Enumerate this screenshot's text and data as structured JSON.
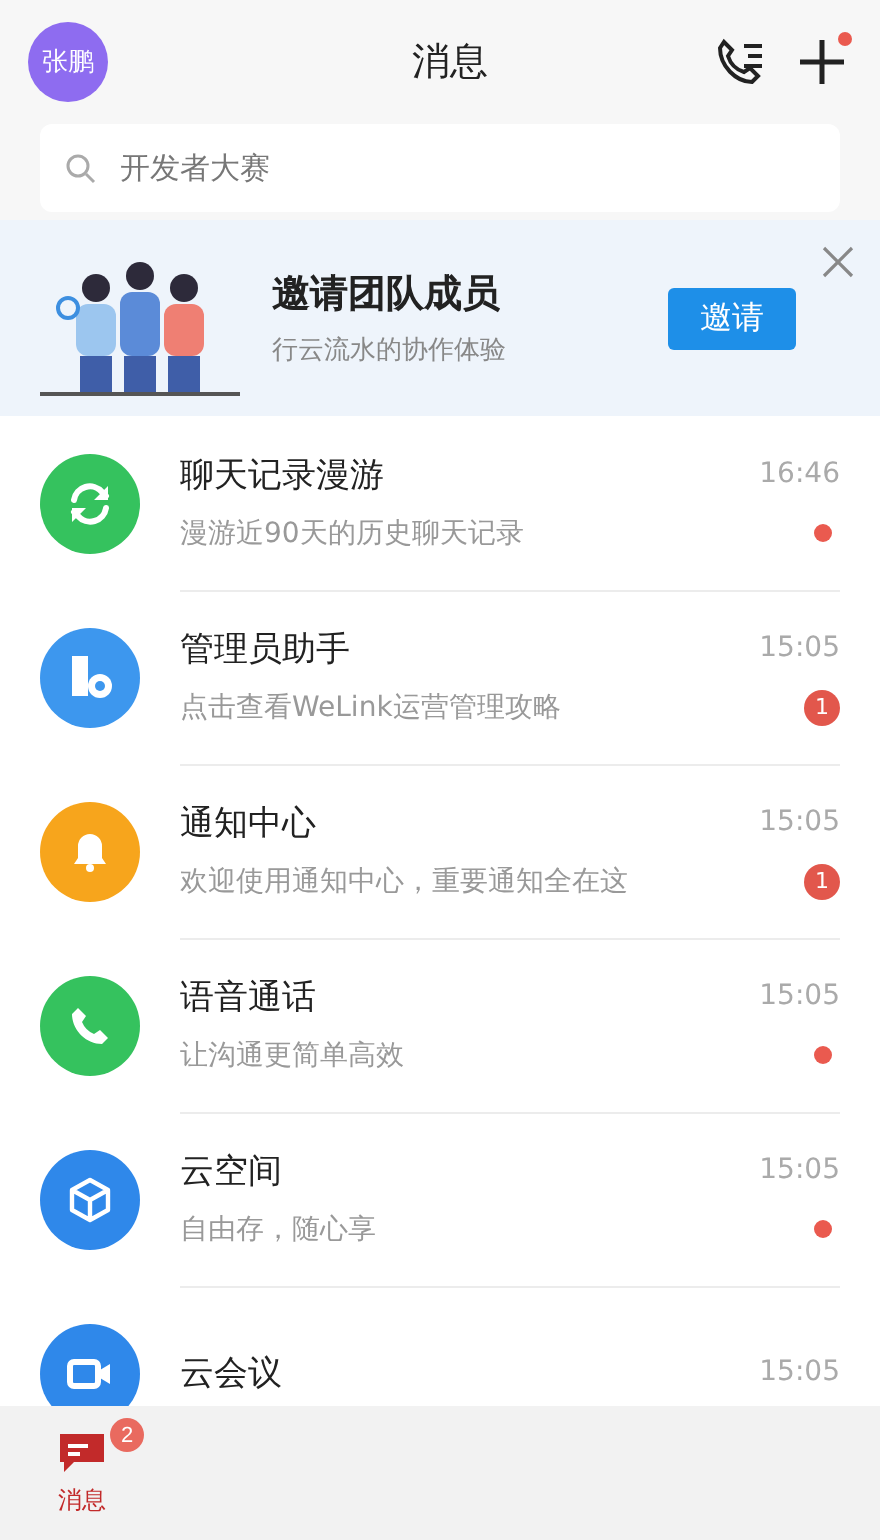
{
  "header": {
    "avatar": "张鹏",
    "title": "消息",
    "plus_dot": true
  },
  "search": {
    "placeholder": "开发者大赛"
  },
  "banner": {
    "title": "邀请团队成员",
    "subtitle": "行云流水的协作体验",
    "button": "邀请"
  },
  "chats": [
    {
      "name": "聊天记录漫游",
      "preview": "漫游近90天的历史聊天记录",
      "time": "16:46",
      "color": "#35c25e",
      "unread": {
        "kind": "dot"
      }
    },
    {
      "name": "管理员助手",
      "preview": "点击查看WeLink运营管理攻略",
      "time": "15:05",
      "color": "#3d97ee",
      "unread": {
        "kind": "count",
        "count": "1"
      }
    },
    {
      "name": "通知中心",
      "preview": "欢迎使用通知中心，重要通知全在这",
      "time": "15:05",
      "color": "#f7a51c",
      "unread": {
        "kind": "count",
        "count": "1"
      }
    },
    {
      "name": "语音通话",
      "preview": "让沟通更简单高效",
      "time": "15:05",
      "color": "#35c25e",
      "unread": {
        "kind": "dot"
      }
    },
    {
      "name": "云空间",
      "preview": "自由存，随心享",
      "time": "15:05",
      "color": "#2f88ea",
      "unread": {
        "kind": "dot"
      }
    },
    {
      "name": "云会议",
      "time": "15:05",
      "color": "#2f88ea"
    }
  ],
  "nav": [
    {
      "label": "消息",
      "selected": true,
      "badge": "2"
    }
  ]
}
